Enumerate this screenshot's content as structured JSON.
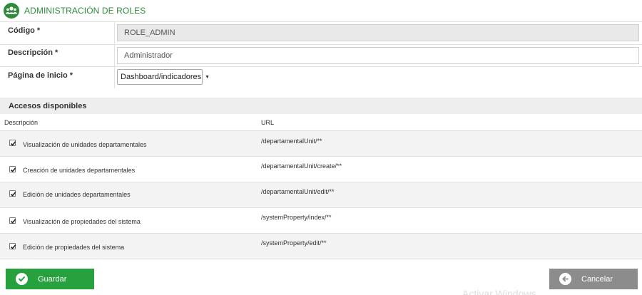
{
  "header": {
    "title": "ADMINISTRACIÓN DE ROLES",
    "icon": "users-group-icon",
    "accent": "#2e8b3a"
  },
  "form": {
    "codigo_label": "Código *",
    "codigo_value": "ROLE_ADMIN",
    "descripcion_label": "Descripción *",
    "descripcion_value": "Administrador",
    "pagina_label": "Página de inicio *",
    "pagina_value": "Dashboard/indicadores"
  },
  "accesos": {
    "title": "Accesos disponibles",
    "col_descripcion": "Descripción",
    "col_url": "URL",
    "rows": [
      {
        "descripcion": "Visualización de unidades departamentales",
        "url": "/departamentalUnit/**",
        "checked": true
      },
      {
        "descripcion": "Creación de unidades departamentales",
        "url": "/departamentalUnit/create/**",
        "checked": true
      },
      {
        "descripcion": "Edición de unidades departamentales",
        "url": "/departamentalUnit/edit/**",
        "checked": true
      },
      {
        "descripcion": "Visualización de propiedades del sistema",
        "url": "/systemProperty/index/**",
        "checked": true
      },
      {
        "descripcion": "Edición de propiedades del sistema",
        "url": "/systemProperty/edit/**",
        "checked": true
      }
    ]
  },
  "buttons": {
    "save_label": "Guardar",
    "cancel_label": "Cancelar",
    "save_color": "#27a13d",
    "cancel_color": "#8c8c8c"
  },
  "watermark": "Activar Windows"
}
